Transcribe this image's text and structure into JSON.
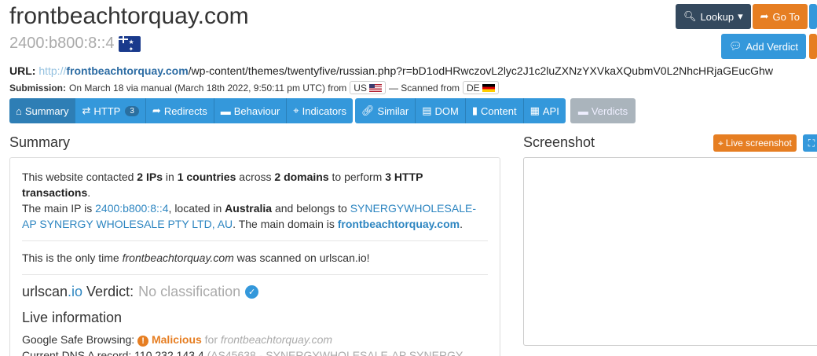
{
  "header": {
    "title": "frontbeachtorquay.com",
    "ip": "2400:b800:8::4",
    "country_flag": "au-flag-icon"
  },
  "buttons": {
    "lookup": "Lookup",
    "goto": "Go To",
    "add_verdict": "Add Verdict"
  },
  "url": {
    "label": "URL:",
    "scheme": "http://",
    "domain": "frontbeachtorquay.com",
    "path": "/wp-content/themes/twentyfive/russian.php?r=bD1odHRwczovL2lyc2J1c2luZXNzYXVkaXQubmV0L2NhcHRjaGEucGhw"
  },
  "submission": {
    "label": "Submission:",
    "text": "On March 18 via manual (March 18th 2022, 9:50:11 pm UTC) from",
    "from_cc": "US",
    "scanned_text": "— Scanned from",
    "scanned_cc": "DE"
  },
  "tabs": {
    "summary": "Summary",
    "http": "HTTP",
    "http_count": "3",
    "redirects": "Redirects",
    "behaviour": "Behaviour",
    "indicators": "Indicators",
    "similar": "Similar",
    "dom": "DOM",
    "content": "Content",
    "api": "API",
    "verdicts": "Verdicts"
  },
  "summary": {
    "heading": "Summary",
    "s1": "This website contacted ",
    "ips": "2 IPs",
    "s2": " in ",
    "countries": "1 countries",
    "s3": " across ",
    "domains": "2 domains",
    "s4": " to perform ",
    "transactions": "3 HTTP transactions",
    "s5": ".",
    "s6": "The main IP is ",
    "main_ip": "2400:b800:8::4",
    "s7": ", located in ",
    "location": "Australia",
    "s8": " and belongs to ",
    "asn": "SYNERGYWHOLESALE-AP SYNERGY WHOLESALE PTY LTD, AU",
    "s9": ". The main domain is ",
    "main_domain": "frontbeachtorquay.com",
    "s10": ".",
    "only_a": "This is the only time ",
    "only_domain": "frontbeachtorquay.com",
    "only_b": " was scanned on urlscan.io!",
    "verdict_a": "urlscan",
    "verdict_b": ".io",
    "verdict_c": " Verdict:",
    "verdict_value": "No classification",
    "live_heading": "Live information",
    "gsb_label": "Google Safe Browsing:",
    "gsb_value": "Malicious",
    "gsb_for": "for",
    "gsb_domain": "frontbeachtorquay.com",
    "dns_label": "Current DNS A record:",
    "dns_value": "110.232.143.4",
    "dns_asn": "(AS45638 - SYNERGYWHOLESALE-AP SYNERGY"
  },
  "screenshot": {
    "heading": "Screenshot",
    "live_btn": "Live screenshot"
  }
}
